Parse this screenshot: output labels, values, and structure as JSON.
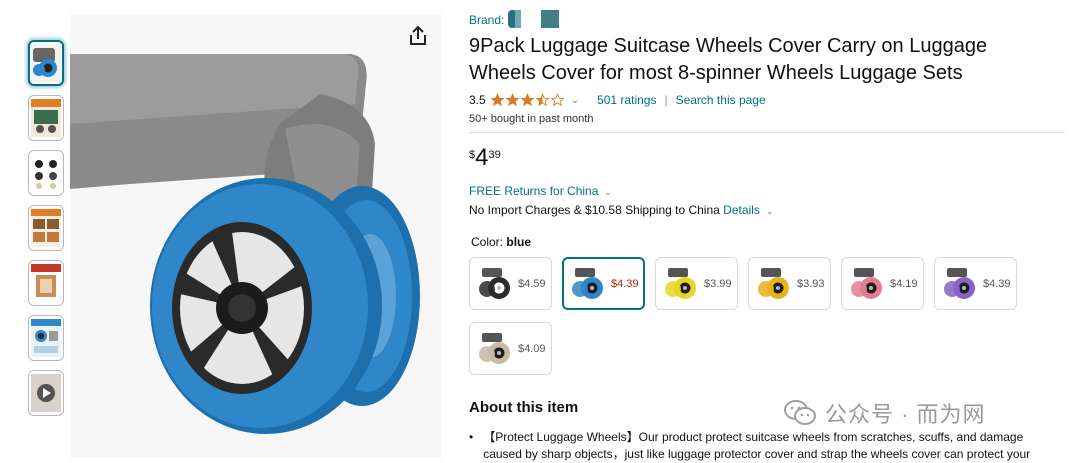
{
  "brand": {
    "label": "Brand:"
  },
  "product": {
    "title": "9Pack Luggage Suitcase Wheels Cover Carry on Luggage Wheels Cover for most 8-spinner Wheels Luggage Sets",
    "rating_value": "3.5",
    "rating_stars": 3.5,
    "ratings_link": "501 ratings",
    "search_link": "Search this page",
    "bought": "50+ bought in past month"
  },
  "price": {
    "symbol": "$",
    "whole": "4",
    "fraction": "39"
  },
  "delivery": {
    "returns": "FREE Returns for China",
    "shipping_text": "No Import Charges & $10.58 Shipping to China",
    "details_link": "Details"
  },
  "color": {
    "label": "Color:",
    "selected": "blue",
    "options": [
      {
        "price": "$4.59",
        "tire": "#2b2b2b",
        "hub": "#ffffff"
      },
      {
        "price": "$4.39",
        "tire": "#2f86c8",
        "hub": "#1e1e1e"
      },
      {
        "price": "$3.99",
        "tire": "#e8d422",
        "hub": "#1e1e1e"
      },
      {
        "price": "$3.93",
        "tire": "#e6b21e",
        "hub": "#1e1e1e"
      },
      {
        "price": "$4.19",
        "tire": "#e27d93",
        "hub": "#1e1e1e"
      },
      {
        "price": "$4.39",
        "tire": "#8a63c2",
        "hub": "#1e1e1e"
      },
      {
        "price": "$4.09",
        "tire": "#c9b9a6",
        "hub": "#1e1e1e"
      }
    ]
  },
  "about": {
    "heading": "About this item",
    "bullet1": "【Protect Luggage Wheels】Our product protect suitcase wheels from scratches, scuffs, and damage caused by sharp objects，just like luggage protector cover and strap the wheels cover can protect your"
  },
  "watermark": {
    "text": "公众号 · 而为网"
  },
  "colors": {
    "link": "#007185",
    "price_sel": "#b12704",
    "wheel_blue": "#2f86c8"
  }
}
